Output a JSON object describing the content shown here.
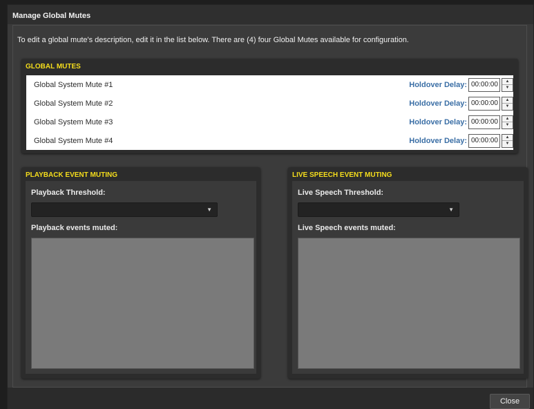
{
  "window": {
    "title": "Manage Global Mutes"
  },
  "intro": "To edit a global mute's description, edit it in the list below. There are (4) four Global Mutes available for configuration.",
  "global_mutes": {
    "title": "GLOBAL MUTES",
    "holdover_label": "Holdover Delay:",
    "items": [
      {
        "name": "Global System Mute #1",
        "delay": "00:00:00"
      },
      {
        "name": "Global System Mute #2",
        "delay": "00:00:00"
      },
      {
        "name": "Global System Mute #3",
        "delay": "00:00:00"
      },
      {
        "name": "Global System Mute #4",
        "delay": "00:00:00"
      }
    ]
  },
  "playback": {
    "title": "PLAYBACK EVENT MUTING",
    "threshold_label": "Playback Threshold:",
    "threshold_value": "",
    "events_label": "Playback events muted:"
  },
  "live_speech": {
    "title": "LIVE SPEECH EVENT MUTING",
    "threshold_label": "Live Speech Threshold:",
    "threshold_value": "",
    "events_label": "Live Speech events muted:"
  },
  "footer": {
    "close_label": "Close"
  },
  "colors": {
    "accent_title": "#f5dd1c",
    "holdover_label": "#3a6ea5"
  }
}
